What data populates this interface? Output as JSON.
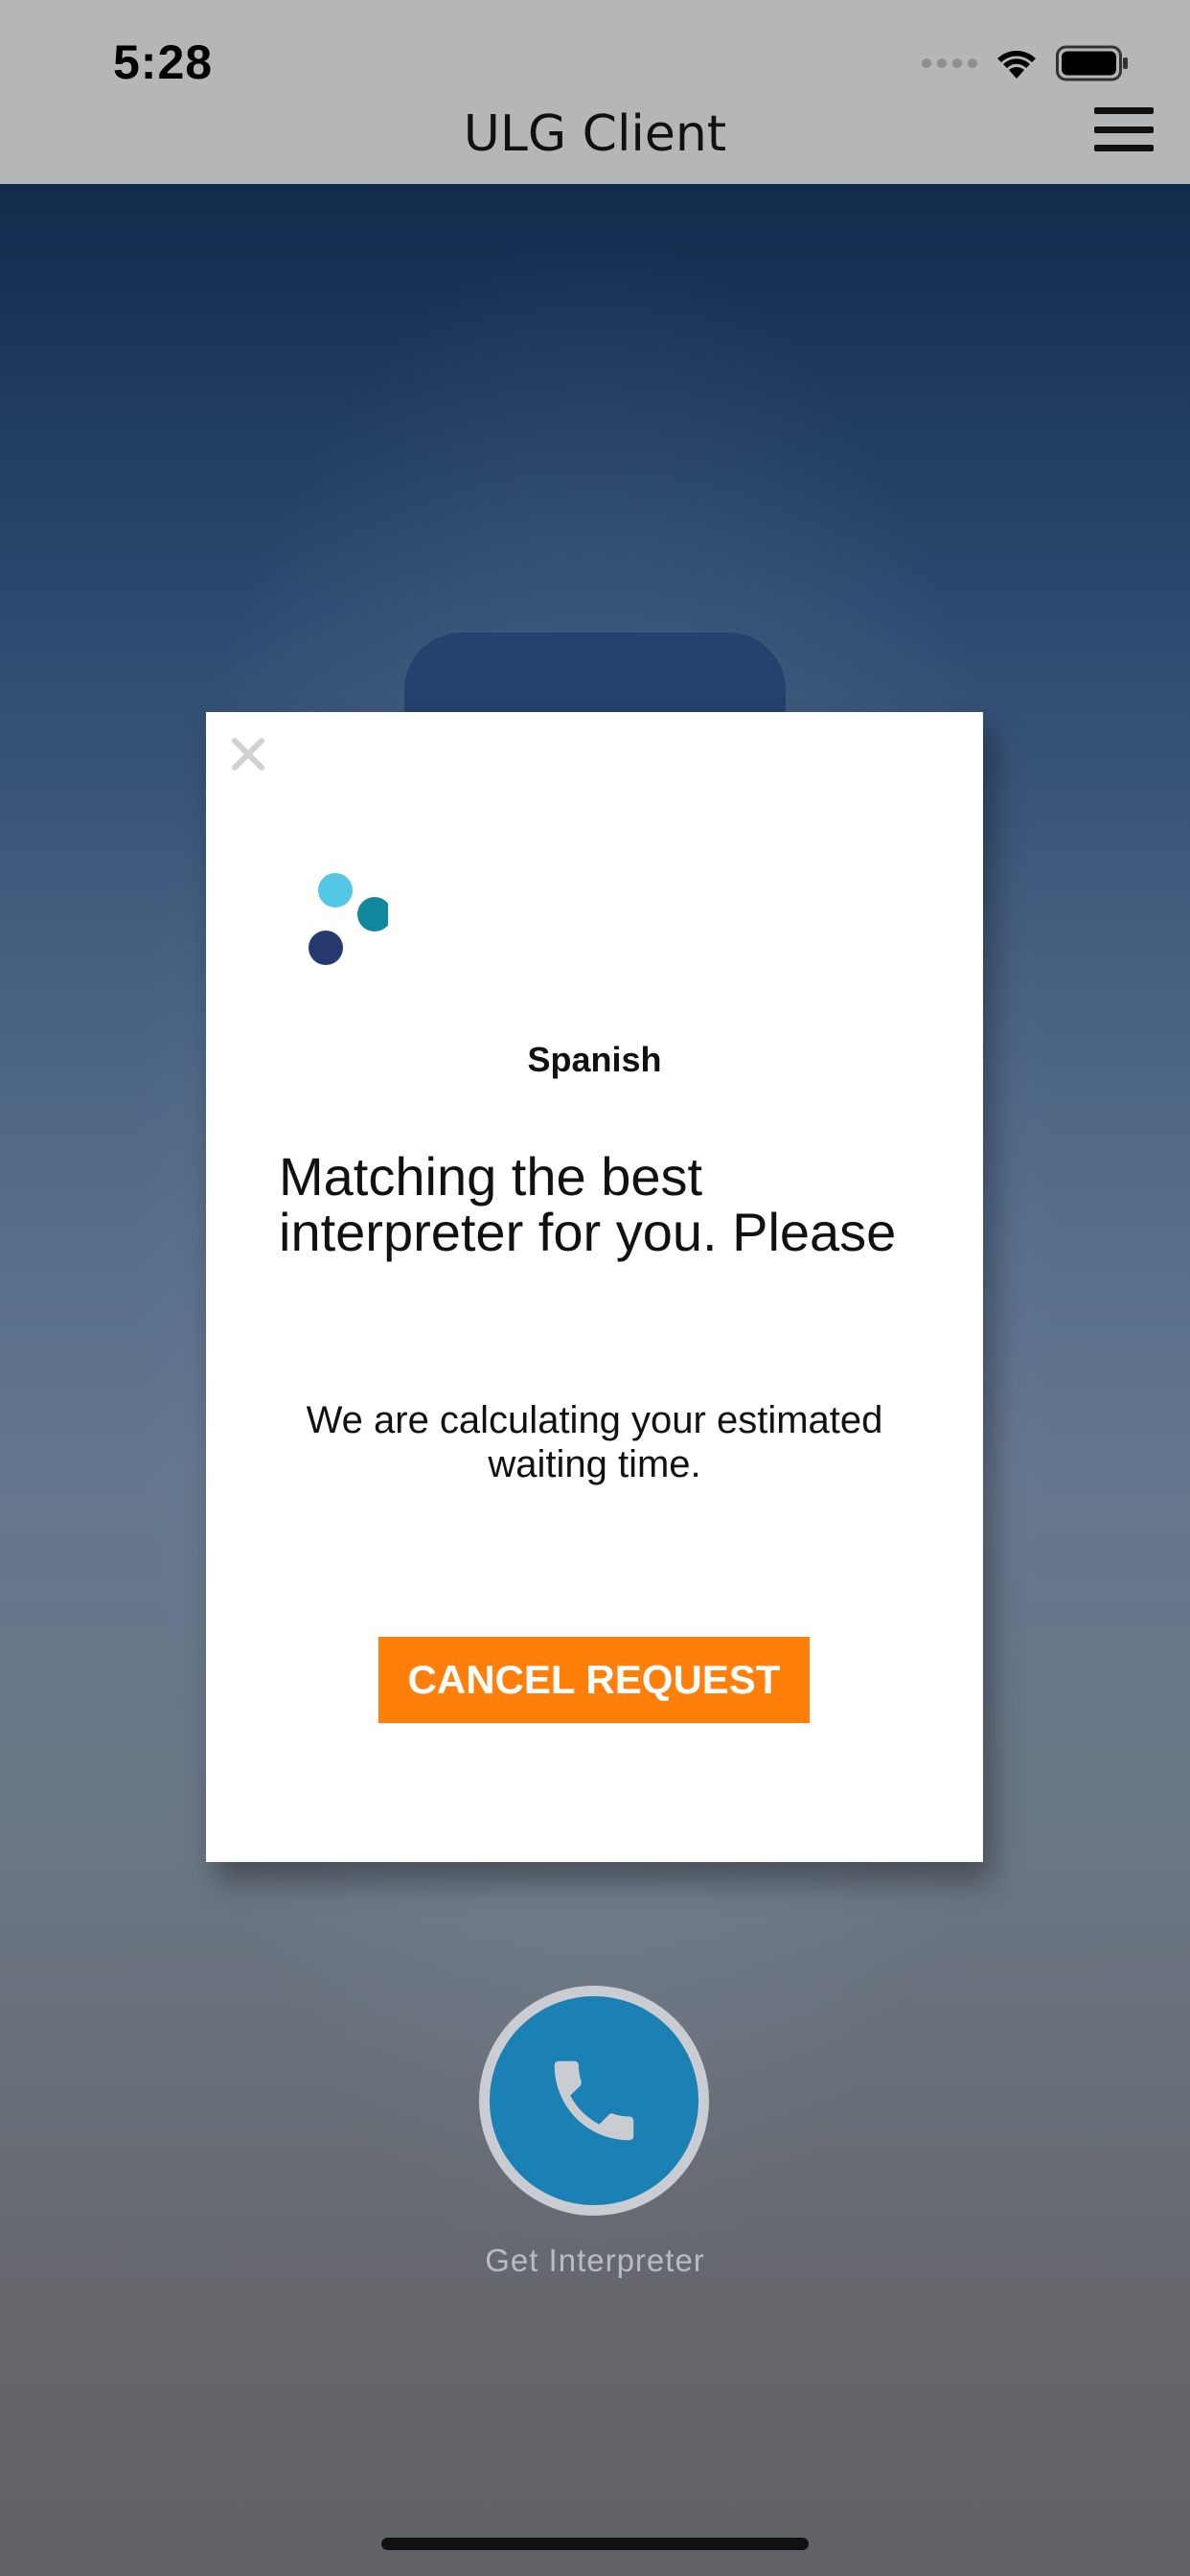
{
  "status_bar": {
    "time": "5:28"
  },
  "header": {
    "title": "ULG Client",
    "menu_icon": "hamburger-menu-icon"
  },
  "main": {
    "call_button_icon": "phone-icon",
    "call_button_label": "Get Interpreter"
  },
  "modal": {
    "close_icon": "close-icon",
    "language": "Spanish",
    "message": "Matching the best interpreter for you. Please",
    "wait_text": "We are calculating your estimated waiting time.",
    "cancel_label": "CANCEL REQUEST"
  },
  "colors": {
    "accent_orange": "#ff7f0a",
    "call_blue": "#1b80b3",
    "loader_light": "#55c7e6",
    "loader_teal": "#12889e",
    "loader_navy": "#25396f"
  }
}
